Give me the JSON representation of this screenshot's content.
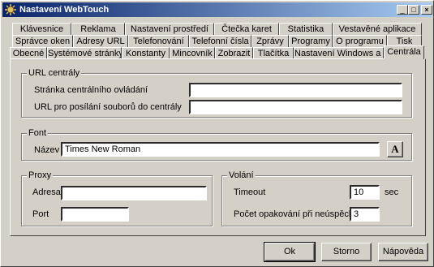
{
  "window": {
    "title": "Nastavení WebTouch",
    "controls": [
      "_",
      "□",
      "×"
    ]
  },
  "tabs": {
    "row1": [
      "Klávesnice",
      "Reklama",
      "Nastavení prostředí",
      "Čtečka karet",
      "Statistika",
      "Vestavěné aplikace"
    ],
    "row2": [
      "Správce oken",
      "Adresy URL",
      "Telefonování",
      "Telefonní čísla",
      "Zprávy",
      "Programy",
      "O programu",
      "Tisk"
    ],
    "row3": [
      "Obecné",
      "Systémové stránky",
      "Konstanty",
      "Mincovník",
      "Zobrazit",
      "Tlačítka",
      "Nastavení Windows a IE",
      "Centrála"
    ],
    "active": "Centrála"
  },
  "url_group": {
    "legend": "URL centrály",
    "control_label": "Stránka centrálního ovládání",
    "control_value": "",
    "upload_label": "URL pro posílání souborů do centrály",
    "upload_value": ""
  },
  "font_group": {
    "legend": "Font",
    "name_label": "Název",
    "name_value": "Times New Roman",
    "font_button": "A"
  },
  "proxy_group": {
    "legend": "Proxy",
    "address_label": "Adresa",
    "address_value": "",
    "port_label": "Port",
    "port_value": ""
  },
  "call_group": {
    "legend": "Volání",
    "timeout_label": "Timeout",
    "timeout_value": "10",
    "timeout_unit": "sec",
    "retries_label": "Počet opakování při neúspěchu",
    "retries_value": "3"
  },
  "buttons": {
    "ok": "Ok",
    "cancel": "Storno",
    "help": "Nápověda"
  }
}
